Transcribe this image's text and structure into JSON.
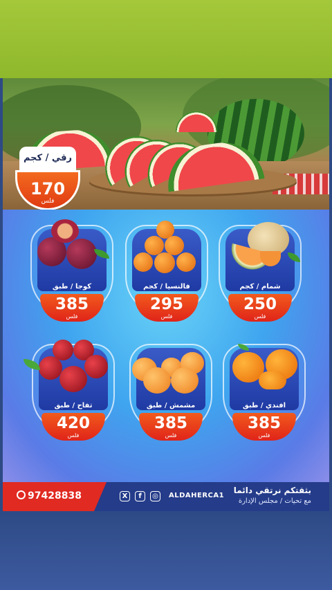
{
  "hero": {
    "watermelon": {
      "label": "رقي / كجم",
      "price": "170",
      "currency": "فلس"
    }
  },
  "products": [
    {
      "name": "كوجا / طبق",
      "price": "385",
      "currency": "فلس",
      "fruit": "plum"
    },
    {
      "name": "فالنسيا / كجم",
      "price": "295",
      "currency": "فلس",
      "fruit": "orange"
    },
    {
      "name": "شمام / كجم",
      "price": "250",
      "currency": "فلس",
      "fruit": "cantaloupe"
    },
    {
      "name": "تفاح / طبق",
      "price": "420",
      "currency": "فلس",
      "fruit": "apple"
    },
    {
      "name": "مشمش / طبق",
      "price": "385",
      "currency": "فلس",
      "fruit": "apricot"
    },
    {
      "name": "افندي / طبق",
      "price": "385",
      "currency": "فلس",
      "fruit": "mandarin"
    }
  ],
  "footer": {
    "phone": "97428838",
    "handle": "ALDAHERCA1",
    "slogan": "بثقتكم نرتقي دائما",
    "sub_slogan": "مع تحيات / مجلس الإدارة",
    "icons": [
      "whatsapp-icon",
      "x-icon",
      "facebook-icon",
      "instagram-icon"
    ]
  },
  "colors": {
    "top_band": "#a4c83a",
    "price_red": "#e0241a",
    "footer_blue": "#253c8a",
    "footer_red": "#e02a22"
  }
}
